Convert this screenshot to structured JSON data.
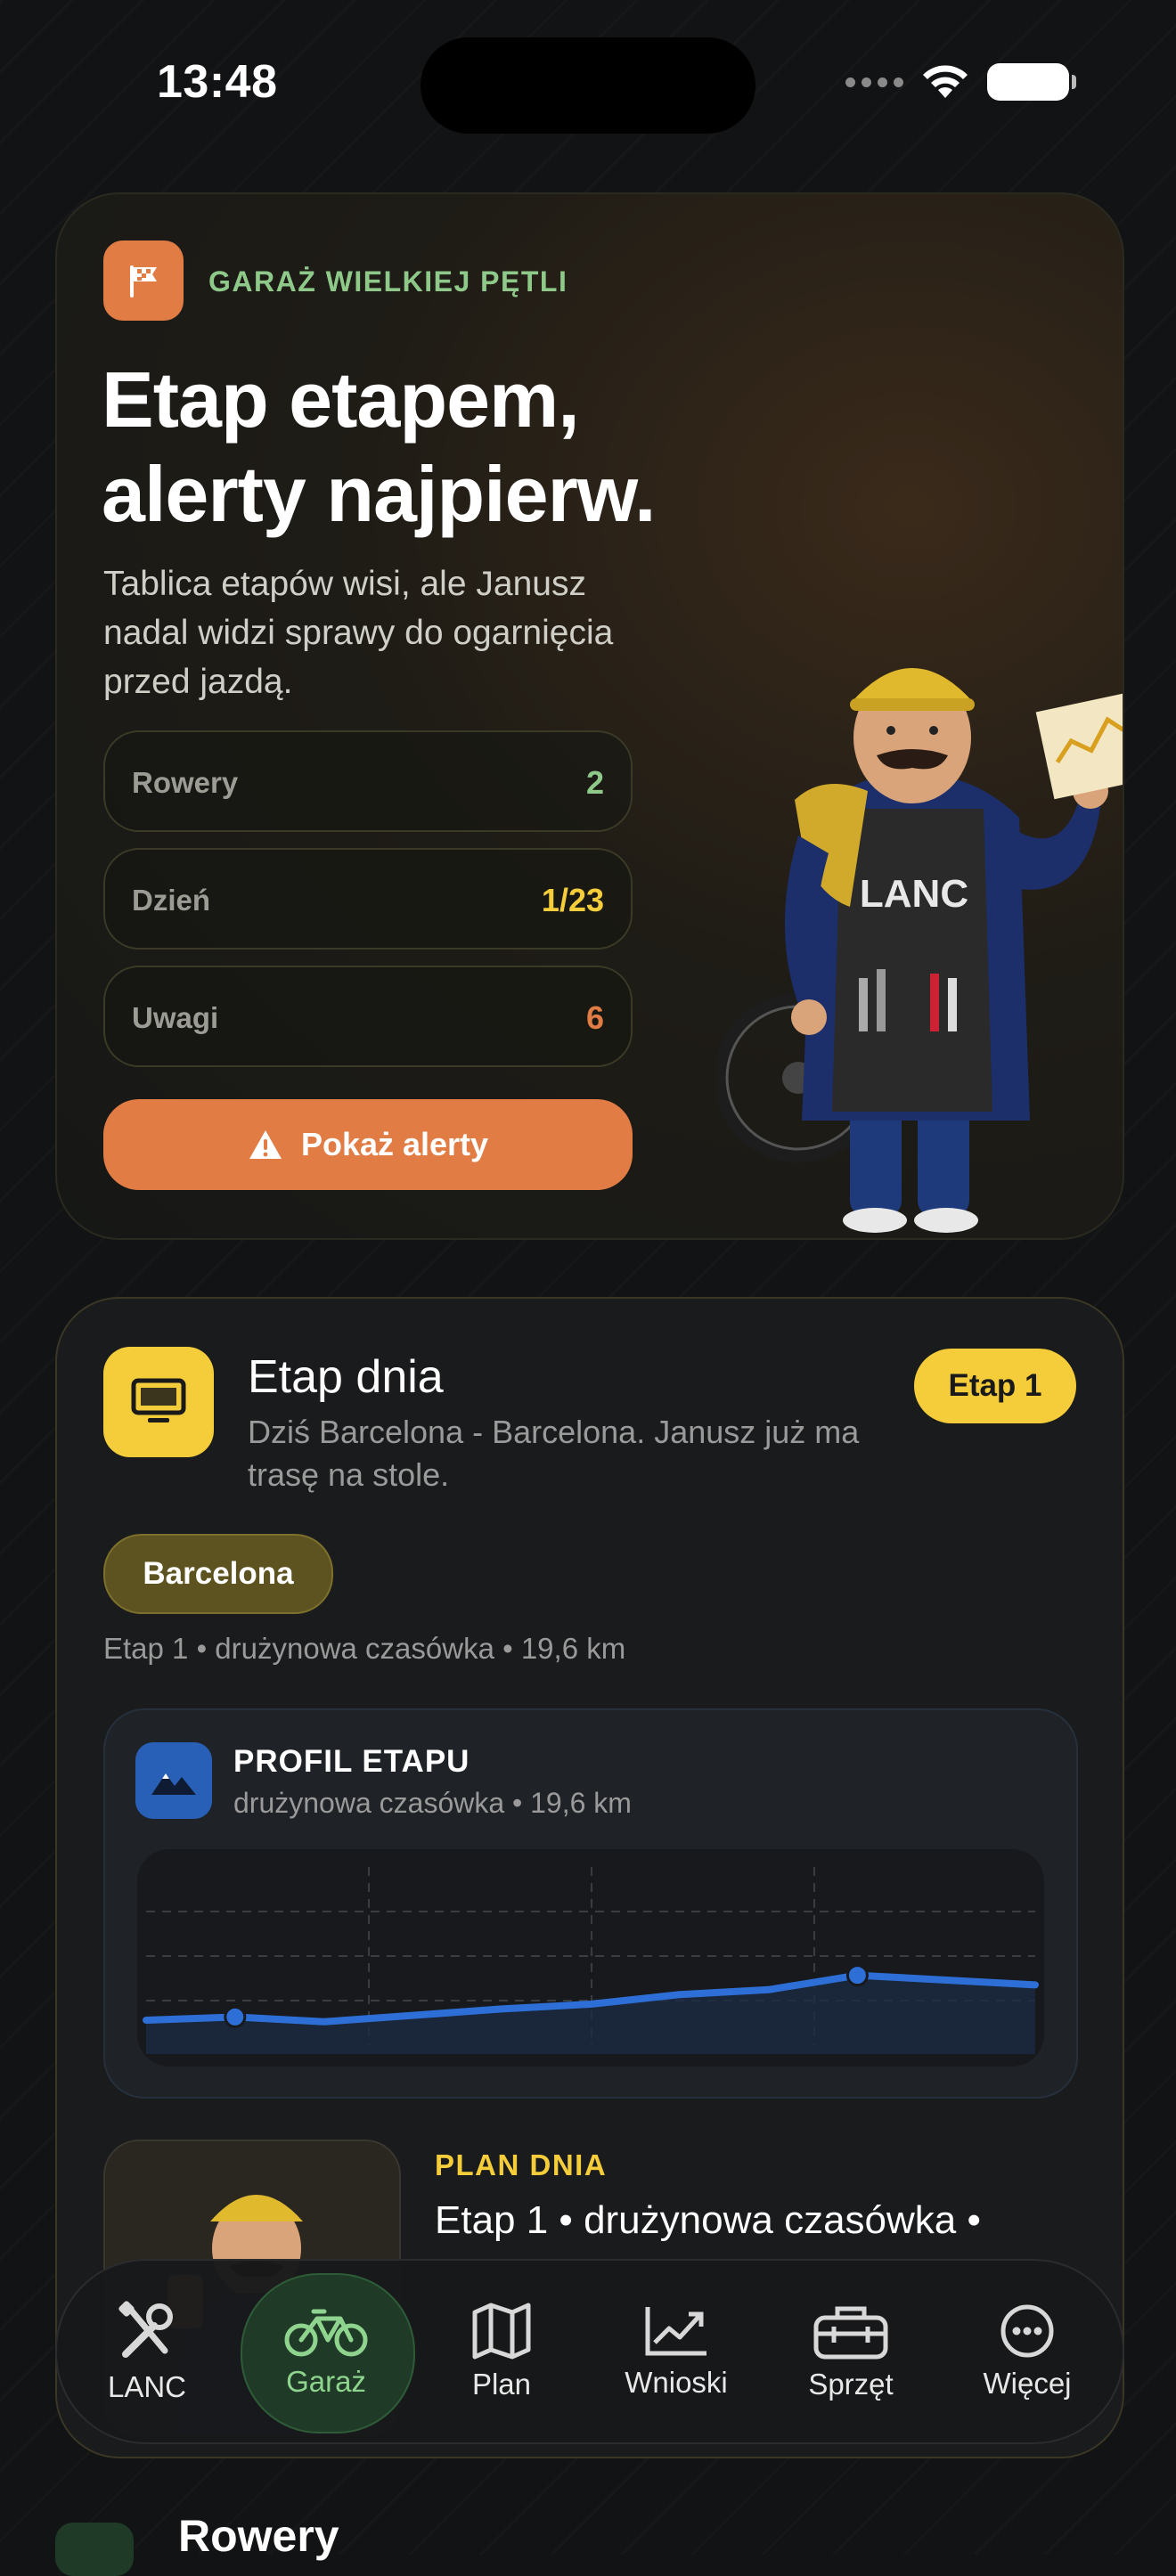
{
  "status_bar": {
    "time": "13:48"
  },
  "hero": {
    "eyebrow": "GARAŻ WIELKIEJ PĘTLI",
    "title": "Etap etapem, alerty najpierw.",
    "subtitle": "Tablica etapów wisi, ale Janusz nadal widzi sprawy do ogarnięcia przed jazdą.",
    "stats": [
      {
        "label": "Rowery",
        "value": "2",
        "color": "#8fc98a"
      },
      {
        "label": "Dzień",
        "value": "1/23",
        "color": "#f5cd3a"
      },
      {
        "label": "Uwagi",
        "value": "6",
        "color": "#e07c44"
      }
    ],
    "alert_button": "Pokaż alerty",
    "apron_text": "LANC"
  },
  "stage_card": {
    "title": "Etap dnia",
    "subtitle": "Dziś Barcelona - Barcelona. Janusz już ma trasę na stole.",
    "badge": "Etap 1",
    "city": "Barcelona",
    "meta": "Etap 1 • drużynowa czasówka • 19,6 km",
    "profile": {
      "title": "PROFIL ETAPU",
      "subtitle": "drużynowa czasówka • 19,6 km",
      "elevation": [
        10,
        12,
        9,
        13,
        17,
        20,
        26,
        29,
        38,
        35,
        32
      ],
      "markers": [
        1,
        8
      ]
    },
    "plan": {
      "eyebrow": "PLAN DNIA",
      "title": "Etap 1 • drużynowa czasówka •"
    }
  },
  "tabbar": {
    "tabs": [
      {
        "label": "LANC",
        "icon": "tools-icon"
      },
      {
        "label": "Garaż",
        "icon": "bicycle-icon"
      },
      {
        "label": "Plan",
        "icon": "map-icon"
      },
      {
        "label": "Wnioski",
        "icon": "trend-chart-icon"
      },
      {
        "label": "Sprzęt",
        "icon": "toolbox-icon"
      },
      {
        "label": "Więcej",
        "icon": "more-icon"
      }
    ],
    "active": "Garaż"
  },
  "next_section": {
    "title": "Rowery"
  }
}
